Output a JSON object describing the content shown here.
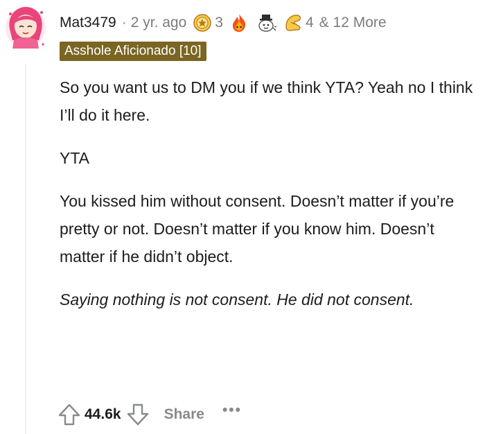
{
  "comment": {
    "username": "Mat3479",
    "separator": "·",
    "timestamp": "2 yr. ago",
    "awards": [
      {
        "icon": "helpful-award-icon",
        "count": "3"
      },
      {
        "icon": "fire-award-icon",
        "count": ""
      },
      {
        "icon": "wholesome-award-icon",
        "count": ""
      },
      {
        "icon": "take-my-energy-award-icon",
        "count": "4"
      }
    ],
    "more_awards_label": "& 12 More",
    "flair": "Asshole Aficionado [10]",
    "flair_color": "#7a6522",
    "paragraphs": [
      "So you want us to DM you if we think YTA? Yeah no I think I’ll do it here.",
      "YTA",
      "You kissed him without consent. Doesn’t matter if you’re pretty or not. Doesn’t matter if you know him. Doesn’t matter if he didn’t object.",
      "Saying nothing is not consent. He did not consent."
    ]
  },
  "actions": {
    "upvote_icon": "upvote-arrow-icon",
    "score": "44.6k",
    "downvote_icon": "downvote-arrow-icon",
    "share_label": "Share",
    "more_label": "•••"
  }
}
